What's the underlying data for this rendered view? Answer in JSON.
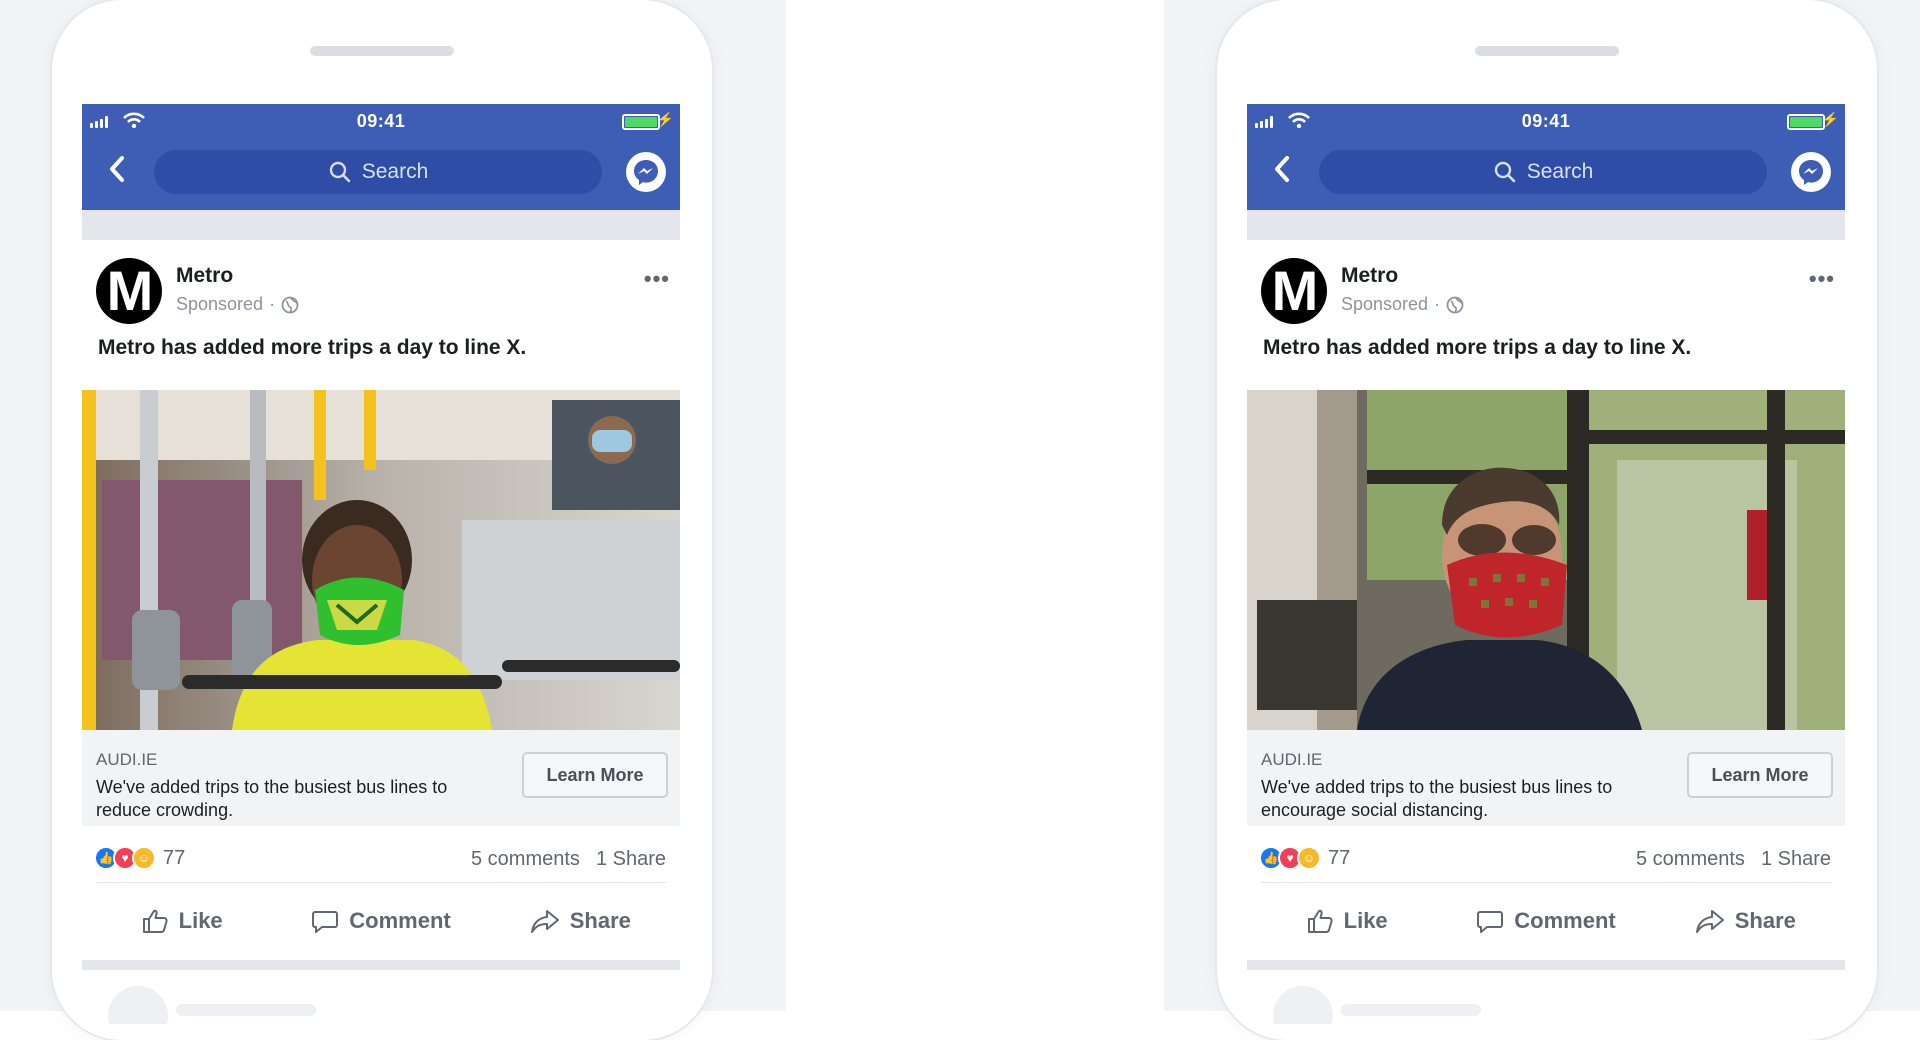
{
  "mockups": [
    {
      "status_time": "09:41",
      "search_placeholder": "Search",
      "page_name": "Metro",
      "sponsored_label": "Sponsored",
      "sponsored_sep": "·",
      "avatar_letter": "M",
      "post_text": "Metro has added more trips a day to line X.",
      "link_domain": "AUDI.IE",
      "link_description": "We've added trips to the busiest bus lines to reduce crowding.",
      "cta_label": "Learn More",
      "reaction_count": "77",
      "comments_label": "5 comments",
      "shares_label": "1 Share",
      "actions": {
        "like": "Like",
        "comment": "Comment",
        "share": "Share"
      },
      "photo": "woman-on-bus-green-mask"
    },
    {
      "status_time": "09:41",
      "search_placeholder": "Search",
      "page_name": "Metro",
      "sponsored_label": "Sponsored",
      "sponsored_sep": "·",
      "avatar_letter": "M",
      "post_text": "Metro has added more trips a day to line X.",
      "link_domain": "AUDI.IE",
      "link_description": "We've added trips to the busiest bus lines to encourage social distancing.",
      "cta_label": "Learn More",
      "reaction_count": "77",
      "comments_label": "5 comments",
      "shares_label": "1 Share",
      "actions": {
        "like": "Like",
        "comment": "Comment",
        "share": "Share"
      },
      "photo": "man-on-bus-red-mask"
    }
  ],
  "colors": {
    "header_blue": "#3e5db5",
    "search_blue": "#2f4da6",
    "battery_green": "#4cd964",
    "like_blue": "#1877f2",
    "love_red": "#f33e58",
    "haha_yellow": "#f7b928"
  }
}
